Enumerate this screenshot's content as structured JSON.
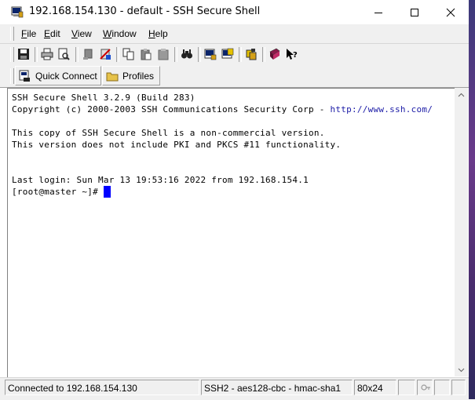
{
  "window": {
    "title": "192.168.154.130 - default - SSH Secure Shell"
  },
  "menu": {
    "items": [
      {
        "label": "File",
        "accel": "F",
        "rest": "ile"
      },
      {
        "label": "Edit",
        "accel": "E",
        "rest": "dit"
      },
      {
        "label": "View",
        "accel": "V",
        "rest": "iew"
      },
      {
        "label": "Window",
        "accel": "W",
        "rest": "indow"
      },
      {
        "label": "Help",
        "accel": "H",
        "rest": "elp"
      }
    ]
  },
  "toolbar": {
    "icons": [
      "save-icon",
      "print-icon",
      "print-preview-icon",
      "disconnect-icon",
      "new-window-icon",
      "copy-icon",
      "paste-icon",
      "paste-selection-icon",
      "find-icon",
      "settings-icon",
      "profile-settings-icon",
      "file-transfer-icon",
      "help-book-icon",
      "whats-this-icon"
    ]
  },
  "quickconnect": {
    "quick_connect_label": "Quick Connect",
    "profiles_label": "Profiles"
  },
  "terminal": {
    "lines": [
      "SSH Secure Shell 3.2.9 (Build 283)",
      "Copyright (c) 2000-2003 SSH Communications Security Corp - ",
      "",
      "This copy of SSH Secure Shell is a non-commercial version.",
      "This version does not include PKI and PKCS #11 functionality.",
      "",
      "",
      "Last login: Sun Mar 13 19:53:16 2022 from 192.168.154.1",
      "[root@master ~]# "
    ],
    "copyright_url": "http://www.ssh.com/"
  },
  "status": {
    "connection": "Connected to 192.168.154.130",
    "cipher": "SSH2 - aes128-cbc - hmac-sha1",
    "size": "80x24"
  },
  "colors": {
    "cursor": "#0000ff",
    "url": "#1a1aa6"
  }
}
